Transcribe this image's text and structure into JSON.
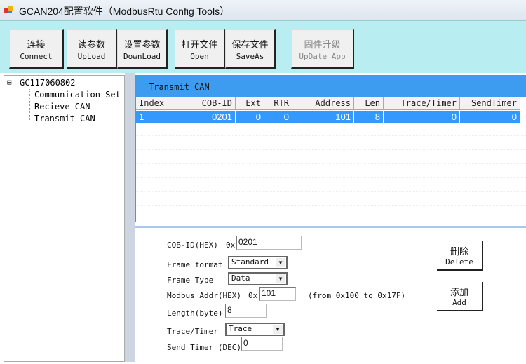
{
  "window": {
    "title": "GCAN204配置软件（ModbusRtu Config Tools）"
  },
  "toolbar": [
    {
      "cn": "连接",
      "en": "Connect"
    },
    {
      "cn": "读参数",
      "en": "UpLoad"
    },
    {
      "cn": "设置参数",
      "en": "DownLoad"
    },
    {
      "cn": "打开文件",
      "en": "Open"
    },
    {
      "cn": "保存文件",
      "en": "SaveAs"
    },
    {
      "cn": "固件升级",
      "en": "UpDate App"
    }
  ],
  "tree": {
    "root": "GC117060802",
    "expander": "⊟",
    "children": [
      "Communication Set",
      "Recieve CAN",
      "Transmit CAN"
    ]
  },
  "panel": {
    "title": "Transmit CAN"
  },
  "table": {
    "columns": [
      "Index",
      "COB-ID",
      "Ext",
      "RTR",
      "Address",
      "Len",
      "Trace/Timer",
      "SendTimer"
    ],
    "rows": [
      [
        "1",
        "0201",
        "0",
        "0",
        "101",
        "8",
        "0",
        "0"
      ]
    ]
  },
  "form": {
    "cobid_label": "COB-ID(HEX)",
    "cobid_prefix": "0x",
    "cobid_value": "0201",
    "frame_format_label": "Frame format",
    "frame_format_value": "Standard",
    "frame_type_label": "Frame Type",
    "frame_type_value": "Data",
    "modbus_label": "Modbus Addr(HEX)",
    "modbus_prefix": "0x",
    "modbus_value": "101",
    "modbus_hint": "(from 0x100 to 0x17F)",
    "length_label": "Length(byte)",
    "length_value": "8",
    "trace_label": "Trace/Timer",
    "trace_value": "Trace",
    "sendtimer_label": "Send Timer (DEC)",
    "sendtimer_value": "0",
    "delete_cn": "删除",
    "delete_en": "Delete",
    "add_cn": "添加",
    "add_en": "Add"
  }
}
